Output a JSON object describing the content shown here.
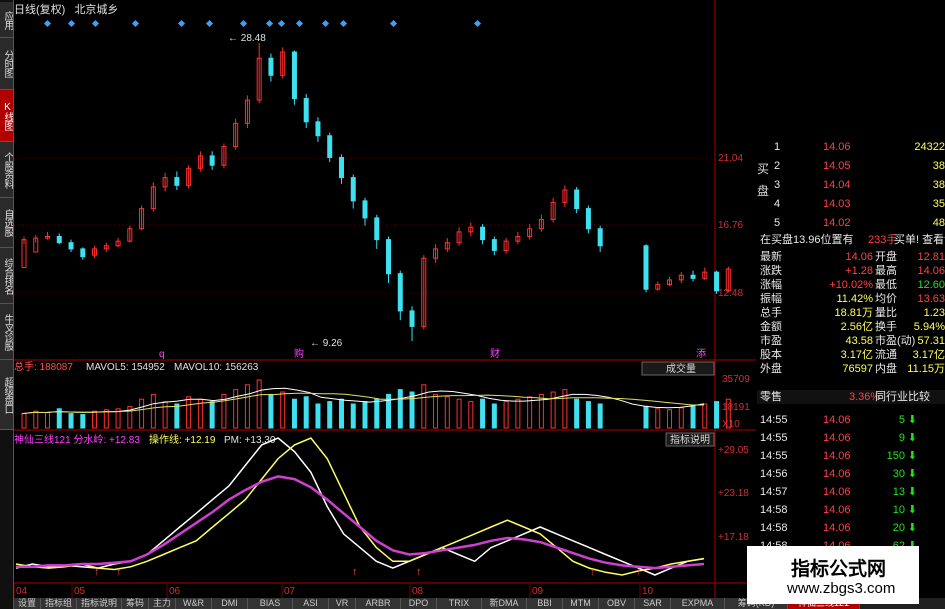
{
  "colors": {
    "up": "#ff3030",
    "down": "#3fe0f0",
    "ma5": "#ffffff",
    "ma10": "#e0e060",
    "line_white": "#ffffff",
    "line_yellow": "#ffff60",
    "line_magenta": "#d040d0",
    "axis": "#b00000"
  },
  "leftnav": [
    {
      "label": "应用",
      "icon": "app-icon"
    },
    {
      "label": "分时图",
      "icon": "timeline-icon"
    },
    {
      "label": "K线图",
      "icon": "kline-icon",
      "active": true
    },
    {
      "label": "个股资料",
      "icon": "info-icon"
    },
    {
      "label": "自选股",
      "icon": "watchlist-icon"
    },
    {
      "label": "综合排名",
      "icon": "rank-icon"
    },
    {
      "label": "牛叉诊股",
      "icon": "diagnose-icon"
    },
    {
      "label": "超级盘口",
      "icon": "orderbook-icon"
    }
  ],
  "chart": {
    "title_period": "日线(复权)",
    "title_name": "北京城乡",
    "price_axis": [
      "21.04",
      "16.76",
      "12.48"
    ],
    "high_label": "28.48",
    "low_label": "9.26",
    "markers": [
      "q",
      "购",
      "财",
      "添"
    ],
    "volume_header": {
      "total": "总手: 188087",
      "ma5": "MAVOL5: 154952",
      "ma10": "MAVOL10: 156263",
      "dropdown": "成交量"
    },
    "volume_axis": [
      "35709",
      "18191",
      "X10"
    ],
    "indicator_header": {
      "name": "神仙三线121 分水岭: +12.83",
      "op": "操作线: +12.19",
      "pm": "PM: +13.30",
      "button": "指标说明"
    },
    "indicator_axis": [
      "+29.05",
      "+23.18",
      "+17.18"
    ],
    "months": [
      "04",
      "05",
      "06",
      "07",
      "08",
      "09",
      "10"
    ],
    "candles": [
      [
        14,
        15.8,
        16.0,
        15.5
      ],
      [
        15,
        15.9,
        16.1,
        15.6
      ],
      [
        15.9,
        16.0,
        16.3,
        15.8
      ],
      [
        16,
        15.6,
        16.2,
        15.5
      ],
      [
        15.6,
        15.2,
        15.8,
        15.0
      ],
      [
        15.2,
        14.7,
        15.3,
        14.5
      ],
      [
        14.8,
        15.2,
        15.4,
        14.6
      ],
      [
        15.2,
        15.4,
        15.6,
        15.0
      ],
      [
        15.4,
        15.7,
        15.9,
        15.3
      ],
      [
        15.7,
        16.5,
        16.7,
        15.6
      ],
      [
        16.5,
        17.8,
        18.0,
        16.4
      ],
      [
        17.8,
        19.2,
        19.5,
        17.6
      ],
      [
        19.2,
        19.8,
        20.1,
        18.9
      ],
      [
        19.8,
        19.3,
        20.2,
        19.0
      ],
      [
        19.3,
        20.4,
        20.6,
        19.1
      ],
      [
        20.4,
        21.2,
        21.5,
        20.2
      ],
      [
        21.2,
        20.6,
        21.5,
        20.3
      ],
      [
        20.6,
        21.8,
        22.0,
        20.4
      ],
      [
        21.8,
        23.3,
        23.6,
        21.6
      ],
      [
        23.3,
        24.8,
        25.1,
        23.0
      ],
      [
        24.8,
        27.5,
        28.48,
        24.6
      ],
      [
        27.5,
        26.4,
        27.8,
        26.0
      ],
      [
        26.4,
        27.9,
        28.2,
        26.2
      ],
      [
        27.9,
        24.9,
        28.0,
        24.5
      ],
      [
        24.9,
        23.4,
        25.2,
        23.0
      ],
      [
        23.4,
        22.5,
        23.7,
        22.1
      ],
      [
        22.5,
        21.1,
        22.7,
        20.8
      ],
      [
        21.1,
        19.8,
        21.3,
        19.4
      ],
      [
        19.8,
        18.3,
        20.0,
        17.8
      ],
      [
        18.3,
        17.2,
        18.5,
        16.7
      ],
      [
        17.2,
        15.8,
        17.4,
        15.2
      ],
      [
        15.8,
        13.6,
        16.0,
        13.0
      ],
      [
        13.6,
        11.2,
        13.8,
        10.6
      ],
      [
        11.2,
        10.2,
        11.5,
        9.26
      ],
      [
        10.2,
        14.6,
        14.8,
        10.0
      ],
      [
        14.6,
        15.2,
        15.5,
        14.3
      ],
      [
        15.2,
        15.6,
        15.9,
        15.0
      ],
      [
        15.6,
        16.3,
        16.6,
        15.4
      ],
      [
        16.3,
        16.6,
        16.9,
        16.0
      ],
      [
        16.6,
        15.8,
        16.8,
        15.5
      ],
      [
        15.8,
        15.1,
        16.0,
        14.8
      ],
      [
        15.1,
        15.7,
        15.9,
        14.9
      ],
      [
        15.7,
        16.0,
        16.3,
        15.5
      ],
      [
        16.0,
        16.5,
        16.8,
        15.8
      ],
      [
        16.5,
        17.1,
        17.4,
        16.3
      ],
      [
        17.1,
        18.2,
        18.5,
        16.9
      ],
      [
        18.2,
        19.0,
        19.3,
        17.9
      ],
      [
        19.0,
        17.8,
        19.2,
        17.5
      ],
      [
        17.8,
        16.5,
        18.0,
        16.2
      ],
      [
        16.5,
        15.4,
        16.7,
        15.0
      ],
      [
        15.4,
        12.6,
        15.5,
        12.4
      ],
      [
        12.6,
        12.9,
        13.1,
        12.5
      ],
      [
        12.9,
        13.2,
        13.4,
        12.8
      ],
      [
        13.2,
        13.5,
        13.7,
        13.0
      ],
      [
        13.5,
        13.3,
        13.8,
        13.1
      ],
      [
        13.3,
        13.7,
        14.0,
        13.2
      ],
      [
        13.7,
        12.5,
        13.8,
        12.3
      ],
      [
        12.5,
        13.9,
        14.06,
        12.4
      ]
    ],
    "volumes": [
      0.3,
      0.35,
      0.32,
      0.4,
      0.3,
      0.28,
      0.35,
      0.38,
      0.4,
      0.45,
      0.6,
      0.7,
      0.55,
      0.5,
      0.65,
      0.6,
      0.55,
      0.7,
      0.8,
      0.9,
      1.0,
      0.7,
      0.75,
      0.6,
      0.65,
      0.5,
      0.55,
      0.6,
      0.5,
      0.55,
      0.6,
      0.7,
      0.8,
      0.75,
      0.9,
      0.7,
      0.65,
      0.6,
      0.55,
      0.6,
      0.5,
      0.55,
      0.6,
      0.65,
      0.7,
      0.75,
      0.8,
      0.6,
      0.55,
      0.5,
      0.45,
      0.4,
      0.38,
      0.42,
      0.45,
      0.5,
      0.55,
      0.6
    ],
    "ind_white": [
      0.05,
      0.08,
      0.06,
      0.07,
      0.06,
      0.05,
      0.08,
      0.1,
      0.15,
      0.25,
      0.35,
      0.45,
      0.55,
      0.65,
      0.8,
      0.95,
      1.0,
      0.9,
      0.75,
      0.5,
      0.3,
      0.2,
      0.1,
      0.05,
      0.1,
      0.15,
      0.2,
      0.15,
      0.1,
      0.2,
      0.25,
      0.3,
      0.35,
      0.3,
      0.25,
      0.2,
      0.15,
      0.1,
      0.05,
      0.0,
      0.05,
      0.1,
      0.12
    ],
    "ind_yellow": [
      0.08,
      0.06,
      0.05,
      0.06,
      0.08,
      0.05,
      0.04,
      0.06,
      0.1,
      0.15,
      0.2,
      0.25,
      0.35,
      0.45,
      0.55,
      0.7,
      0.85,
      0.95,
      1.0,
      0.85,
      0.6,
      0.35,
      0.2,
      0.1,
      0.1,
      0.15,
      0.2,
      0.25,
      0.3,
      0.35,
      0.4,
      0.35,
      0.3,
      0.2,
      0.1,
      0.05,
      0.02,
      0.0,
      0.03,
      0.05,
      0.08,
      0.1,
      0.12
    ],
    "ind_magenta": [
      0.06,
      0.06,
      0.07,
      0.07,
      0.08,
      0.08,
      0.09,
      0.1,
      0.15,
      0.22,
      0.3,
      0.38,
      0.46,
      0.55,
      0.62,
      0.68,
      0.72,
      0.7,
      0.64,
      0.55,
      0.45,
      0.35,
      0.25,
      0.18,
      0.15,
      0.16,
      0.18,
      0.2,
      0.22,
      0.25,
      0.27,
      0.26,
      0.24,
      0.2,
      0.16,
      0.12,
      0.09,
      0.07,
      0.06,
      0.05,
      0.06,
      0.07,
      0.08
    ]
  },
  "bids": [
    {
      "level": "1",
      "price": "14.06",
      "vol": "24322"
    },
    {
      "level": "2",
      "price": "14.05",
      "vol": "38"
    },
    {
      "level": "3",
      "price": "14.04",
      "vol": "38"
    },
    {
      "level": "4",
      "price": "14.03",
      "vol": "35"
    },
    {
      "level": "5",
      "price": "14.02",
      "vol": "48"
    }
  ],
  "bid_side_label": "买盘",
  "bid_summary": {
    "text": "在买盘13.96位置有",
    "count": "233手",
    "buy": "买单! 查看详细"
  },
  "quote_rows": [
    {
      "k1": "最新",
      "v1": "14.06",
      "k2": "开盘",
      "v2": "12.81"
    },
    {
      "k1": "涨跌",
      "v1": "+1.28",
      "k2": "最高",
      "v2": "14.06"
    },
    {
      "k1": "涨幅",
      "v1": "+10.02%",
      "k2": "最低",
      "v2": "12.60"
    },
    {
      "k1": "振幅",
      "v1": "11.42%",
      "k2": "均价",
      "v2": "13.63"
    },
    {
      "k1": "总手",
      "v1": "18.81万",
      "k2": "量比",
      "v2": "1.23"
    },
    {
      "k1": "金额",
      "v1": "2.56亿",
      "k2": "换手",
      "v2": "5.94%"
    },
    {
      "k1": "市盈",
      "v1": "43.58",
      "k2": "市盈(动)",
      "v2": "57.31"
    },
    {
      "k1": "股本",
      "v1": "3.17亿",
      "k2": "流通",
      "v2": "3.17亿"
    },
    {
      "k1": "外盘",
      "v1": "76597",
      "k2": "内盘",
      "v2": "11.15万"
    }
  ],
  "sector": {
    "name": "零售",
    "pct": "3.36%",
    "compare": "同行业比较"
  },
  "ticks": [
    {
      "t": "14:55",
      "p": "14.06",
      "v": "5",
      "dir": "down"
    },
    {
      "t": "14:55",
      "p": "14.06",
      "v": "9",
      "dir": "down"
    },
    {
      "t": "14:55",
      "p": "14.06",
      "v": "150",
      "dir": "down"
    },
    {
      "t": "14:56",
      "p": "14.06",
      "v": "30",
      "dir": "down"
    },
    {
      "t": "14:57",
      "p": "14.06",
      "v": "13",
      "dir": "down"
    },
    {
      "t": "14:58",
      "p": "14.06",
      "v": "10",
      "dir": "down"
    },
    {
      "t": "14:58",
      "p": "14.06",
      "v": "20",
      "dir": "down"
    },
    {
      "t": "14:58",
      "p": "14.06",
      "v": "62",
      "dir": "down"
    }
  ],
  "bottom_tabs": [
    "设置",
    "指标组",
    "指标说明",
    "筹码",
    "主力",
    "W&R",
    "DMI",
    "BIAS",
    "ASI",
    "VR",
    "ARBR",
    "DPO",
    "TRIX",
    "新DMA",
    "BBI",
    "MTM",
    "OBV",
    "SAR",
    "EXPMA",
    "筹码(KD)",
    "神仙三线121"
  ],
  "watermark": {
    "title": "指标公式网",
    "url": "www.zbgs3.com"
  }
}
